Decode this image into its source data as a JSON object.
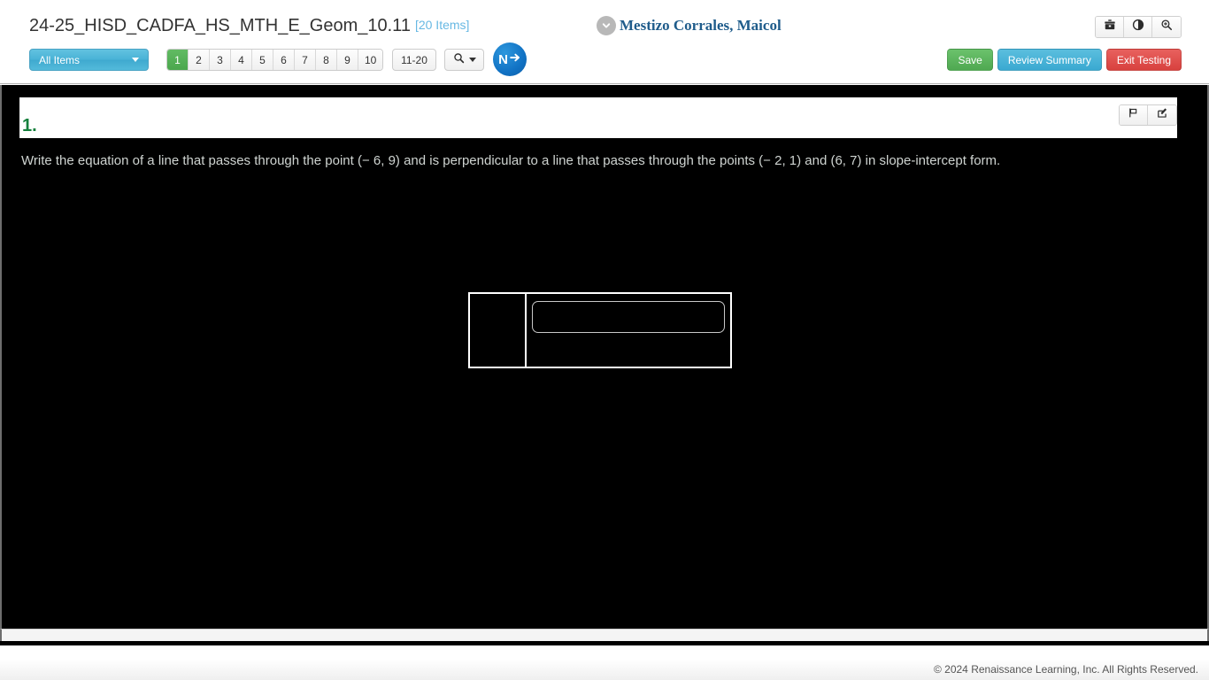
{
  "header": {
    "assessment_title": "24-25_HISD_CADFA_HS_MTH_E_Geom_10.11",
    "item_count_label": "[20 Items]",
    "student_name": "Mestizo Corrales, Maicol",
    "icons": {
      "toolbox": "toolbox-icon",
      "contrast": "contrast-icon",
      "zoom": "zoom-icon"
    }
  },
  "toolbar": {
    "filter_label": "All Items",
    "pages": [
      "1",
      "2",
      "3",
      "4",
      "5",
      "6",
      "7",
      "8",
      "9",
      "10"
    ],
    "active_page": "1",
    "page_range_label": "11-20",
    "search_label": "search-dropdown",
    "next_label": "N",
    "save_label": "Save",
    "review_summary_label": "Review Summary",
    "exit_testing_label": "Exit Testing"
  },
  "question": {
    "number": "1.",
    "text": "Write the equation of a line that passes through the point (− 6, 9) and is perpendicular to a line that passes through the points (− 2, 1) and (6, 7) in slope-intercept form.",
    "flag_icon": "flag-icon",
    "edit_icon": "edit-icon",
    "answer_value": "",
    "answer_placeholder": ""
  },
  "footer": {
    "copyright": "© 2024 Renaissance Learning, Inc. All Rights Reserved."
  },
  "colors": {
    "accent_green": "#4ba74d",
    "accent_blue": "#3aa9d1",
    "accent_red": "#d8413e",
    "question_number_green": "#15803d",
    "item_count_blue": "#67b8e3",
    "student_name_blue": "#1f5c8b"
  }
}
